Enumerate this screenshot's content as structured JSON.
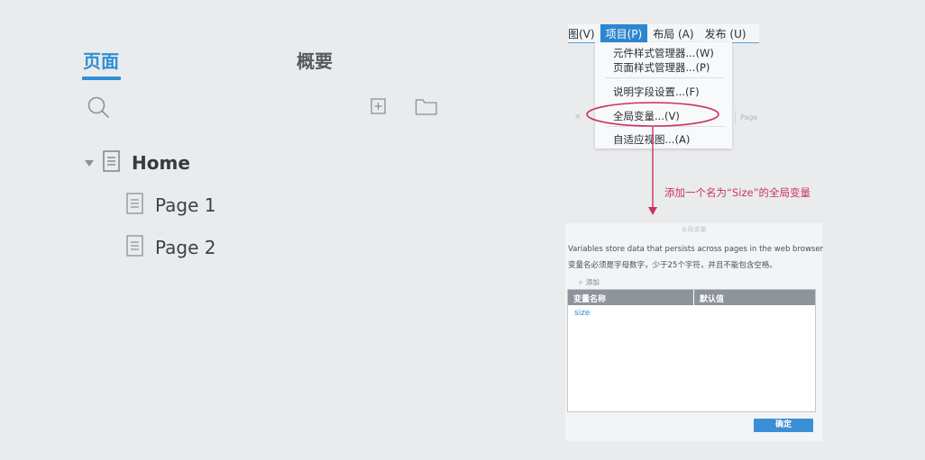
{
  "pages_panel": {
    "tabs": [
      {
        "label": "页面",
        "active": true
      },
      {
        "label": "概要",
        "active": false
      }
    ],
    "tree": [
      {
        "label": "Home",
        "level": 0,
        "expanded": true
      },
      {
        "label": "Page 1",
        "level": 1
      },
      {
        "label": "Page 2",
        "level": 1
      }
    ],
    "accent_color": "#2f8fd4"
  },
  "menubar": {
    "items": [
      {
        "label": "图(V)"
      },
      {
        "label": "项目(P)",
        "active": true
      },
      {
        "label": "布局 (A)"
      },
      {
        "label": "发布 (U)"
      }
    ]
  },
  "dropdown": {
    "items": [
      {
        "label": "元件样式管理器...(W)"
      },
      {
        "label": "页面样式管理器...(P)"
      },
      {
        "label": "说明字段设置...(F)"
      },
      {
        "label": "全局变量...(V)",
        "highlighted": true
      },
      {
        "label": "自适应视图...(A)"
      }
    ]
  },
  "background_fragments": {
    "x_mark": "×",
    "page_text": "Page"
  },
  "annotation": {
    "text": "添加一个名为“Size”的全局变量",
    "color": "#c9335e"
  },
  "dialog": {
    "title": "全局变量",
    "description": "Variables store data that persists across pages in the web browser",
    "rule": "变量名必须是字母数字，少于25个字符，并且不能包含空格。",
    "add_label": "添加",
    "table": {
      "columns": [
        "变量名称",
        "默认值"
      ],
      "rows": [
        {
          "name": "size",
          "default": ""
        }
      ]
    },
    "ok_label": "确定"
  }
}
